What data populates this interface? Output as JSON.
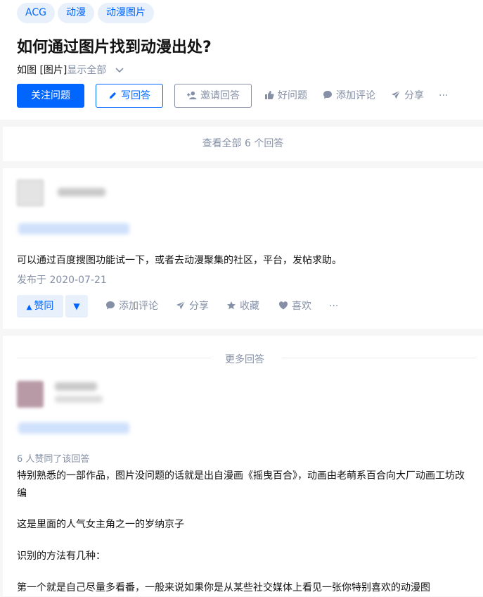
{
  "tags": [
    "ACG",
    "动漫",
    "动漫图片"
  ],
  "question": {
    "title": "如何通过图片找到动漫出处?",
    "detail": "如图 [图片]",
    "show_all": "显示全部"
  },
  "actions": {
    "follow": "关注问题",
    "write": "写回答",
    "invite": "邀请回答",
    "good_question": "好问题",
    "comment": "添加评论",
    "share": "分享",
    "more": "···"
  },
  "view_all": "查看全部 6 个回答",
  "answer": {
    "content": "可以通过百度搜图功能试一下，或者去动漫聚集的社区，平台，发帖求助。",
    "date": "发布于 2020-07-21",
    "vote_up": "赞同",
    "vote_down": "▼",
    "comment": "添加评论",
    "share": "分享",
    "collect": "收藏",
    "like": "喜欢",
    "more": "···"
  },
  "more_answers": {
    "divider": "更多回答",
    "voters": "6 人赞同了该回答",
    "paragraphs": [
      "特别熟悉的一部作品，图片没问题的话就是出自漫画《摇曳百合》，动画由老萌系百合向大厂动画工坊改编",
      "这是里面的人气女主角之一的岁纳京子",
      "识别的方法有几种：",
      "第一个就是自己尽量多看番，一般来说如果你是从某些社交媒体上看见一张你特别喜欢的动漫图"
    ]
  },
  "colors": {
    "brand": "#0066ff",
    "muted": "#8590a6",
    "tag_bg": "#e8f0fc",
    "page_bg": "#f6f6f6"
  }
}
